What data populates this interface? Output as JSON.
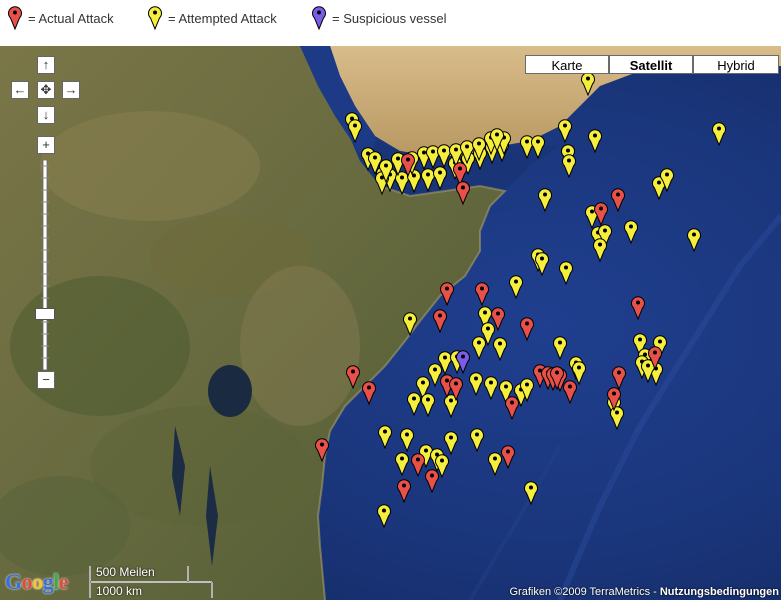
{
  "legend": {
    "actual": {
      "label": "= Actual Attack",
      "color": "#e8504a"
    },
    "attempted": {
      "label": "= Attempted Attack",
      "color": "#f5ee3c"
    },
    "suspicious": {
      "label": "= Suspicious vessel",
      "color": "#7a5ce8"
    }
  },
  "map_types": [
    {
      "label": "Karte",
      "active": false
    },
    {
      "label": "Satellit",
      "active": true
    },
    {
      "label": "Hybrid",
      "active": false
    }
  ],
  "controls": {
    "pan_up": "↑",
    "pan_left": "←",
    "pan_center": "✥",
    "pan_right": "→",
    "pan_down": "↓",
    "zoom_in": "+",
    "zoom_out": "−",
    "zoom_level": 0.77
  },
  "logo": "Google",
  "scale": {
    "miles": "500 Meilen",
    "km": "1000 km"
  },
  "copyright": {
    "text": "Grafiken ©2009 TerraMetrics - ",
    "link": "Nutzungsbedingungen"
  },
  "markers": {
    "actual": [
      [
        408,
        165
      ],
      [
        460,
        174
      ],
      [
        463,
        193
      ],
      [
        618,
        200
      ],
      [
        601,
        214
      ],
      [
        447,
        294
      ],
      [
        482,
        294
      ],
      [
        440,
        321
      ],
      [
        498,
        319
      ],
      [
        527,
        329
      ],
      [
        638,
        308
      ],
      [
        353,
        377
      ],
      [
        369,
        393
      ],
      [
        447,
        386
      ],
      [
        456,
        389
      ],
      [
        512,
        408
      ],
      [
        540,
        376
      ],
      [
        548,
        378
      ],
      [
        553,
        379
      ],
      [
        560,
        380
      ],
      [
        570,
        392
      ],
      [
        614,
        399
      ],
      [
        619,
        378
      ],
      [
        655,
        358
      ],
      [
        322,
        450
      ],
      [
        418,
        465
      ],
      [
        432,
        481
      ],
      [
        404,
        491
      ],
      [
        508,
        457
      ],
      [
        557,
        378
      ]
    ],
    "attempted": [
      [
        352,
        124
      ],
      [
        355,
        131
      ],
      [
        368,
        159
      ],
      [
        375,
        163
      ],
      [
        383,
        178
      ],
      [
        390,
        180
      ],
      [
        402,
        183
      ],
      [
        414,
        181
      ],
      [
        428,
        180
      ],
      [
        440,
        178
      ],
      [
        455,
        168
      ],
      [
        468,
        163
      ],
      [
        480,
        158
      ],
      [
        492,
        152
      ],
      [
        502,
        150
      ],
      [
        382,
        183
      ],
      [
        386,
        171
      ],
      [
        398,
        164
      ],
      [
        412,
        163
      ],
      [
        424,
        158
      ],
      [
        433,
        157
      ],
      [
        444,
        156
      ],
      [
        456,
        155
      ],
      [
        467,
        152
      ],
      [
        479,
        149
      ],
      [
        491,
        143
      ],
      [
        504,
        143
      ],
      [
        497,
        140
      ],
      [
        527,
        147
      ],
      [
        538,
        147
      ],
      [
        565,
        131
      ],
      [
        568,
        156
      ],
      [
        569,
        166
      ],
      [
        595,
        141
      ],
      [
        588,
        84
      ],
      [
        719,
        134
      ],
      [
        545,
        200
      ],
      [
        592,
        217
      ],
      [
        598,
        238
      ],
      [
        605,
        236
      ],
      [
        600,
        250
      ],
      [
        631,
        232
      ],
      [
        659,
        188
      ],
      [
        667,
        180
      ],
      [
        694,
        240
      ],
      [
        538,
        260
      ],
      [
        542,
        264
      ],
      [
        566,
        273
      ],
      [
        516,
        287
      ],
      [
        410,
        324
      ],
      [
        485,
        318
      ],
      [
        488,
        334
      ],
      [
        479,
        348
      ],
      [
        500,
        349
      ],
      [
        435,
        375
      ],
      [
        445,
        363
      ],
      [
        457,
        362
      ],
      [
        423,
        388
      ],
      [
        428,
        405
      ],
      [
        414,
        404
      ],
      [
        451,
        406
      ],
      [
        476,
        384
      ],
      [
        491,
        388
      ],
      [
        506,
        392
      ],
      [
        521,
        395
      ],
      [
        527,
        390
      ],
      [
        560,
        348
      ],
      [
        576,
        368
      ],
      [
        579,
        373
      ],
      [
        614,
        407
      ],
      [
        617,
        418
      ],
      [
        640,
        345
      ],
      [
        660,
        347
      ],
      [
        645,
        360
      ],
      [
        656,
        374
      ],
      [
        642,
        367
      ],
      [
        648,
        371
      ],
      [
        385,
        437
      ],
      [
        407,
        440
      ],
      [
        451,
        443
      ],
      [
        477,
        440
      ],
      [
        402,
        464
      ],
      [
        426,
        456
      ],
      [
        437,
        460
      ],
      [
        442,
        466
      ],
      [
        495,
        464
      ],
      [
        531,
        493
      ],
      [
        384,
        516
      ]
    ],
    "suspicious": [
      [
        463,
        362
      ]
    ]
  }
}
